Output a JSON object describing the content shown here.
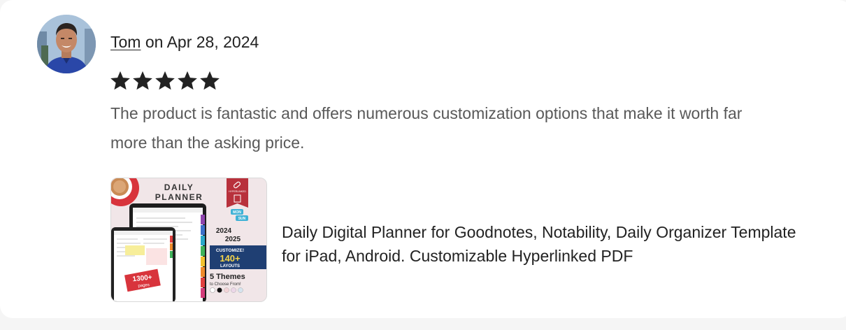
{
  "review": {
    "reviewer_name": "Tom",
    "date_prefix": " on ",
    "date": "Apr 28, 2024",
    "rating": 5,
    "rating_max": 5,
    "text": "The product is fantastic and offers numerous customization options that make it worth far more than the asking price."
  },
  "product": {
    "title": "Daily Digital Planner for Goodnotes, Notability, Daily Organizer Template for iPad, Android. Customizable Hyperlinked PDF",
    "image": {
      "heading_line1": "DAILY",
      "heading_line2": "PLANNER",
      "year1": "2024",
      "year2": "2025",
      "badge_line1": "CUSTOMIZE!",
      "badge_line2": "140+",
      "badge_line3": "LAYOUTS",
      "themes_line1": "5 Themes",
      "themes_line2": "to Choose From!",
      "pages_line1": "1300+",
      "pages_line2": "pages",
      "tag_mon": "MON",
      "tag_sun": "SUN",
      "hyperlinked": "HYPERLINKED"
    }
  },
  "colors": {
    "star": "#222222",
    "text_muted": "#595959",
    "accent_red": "#b8313c",
    "badge_navy": "#1f3f73"
  },
  "icons": {
    "star": "star-icon",
    "link": "link-icon",
    "document": "document-icon"
  }
}
